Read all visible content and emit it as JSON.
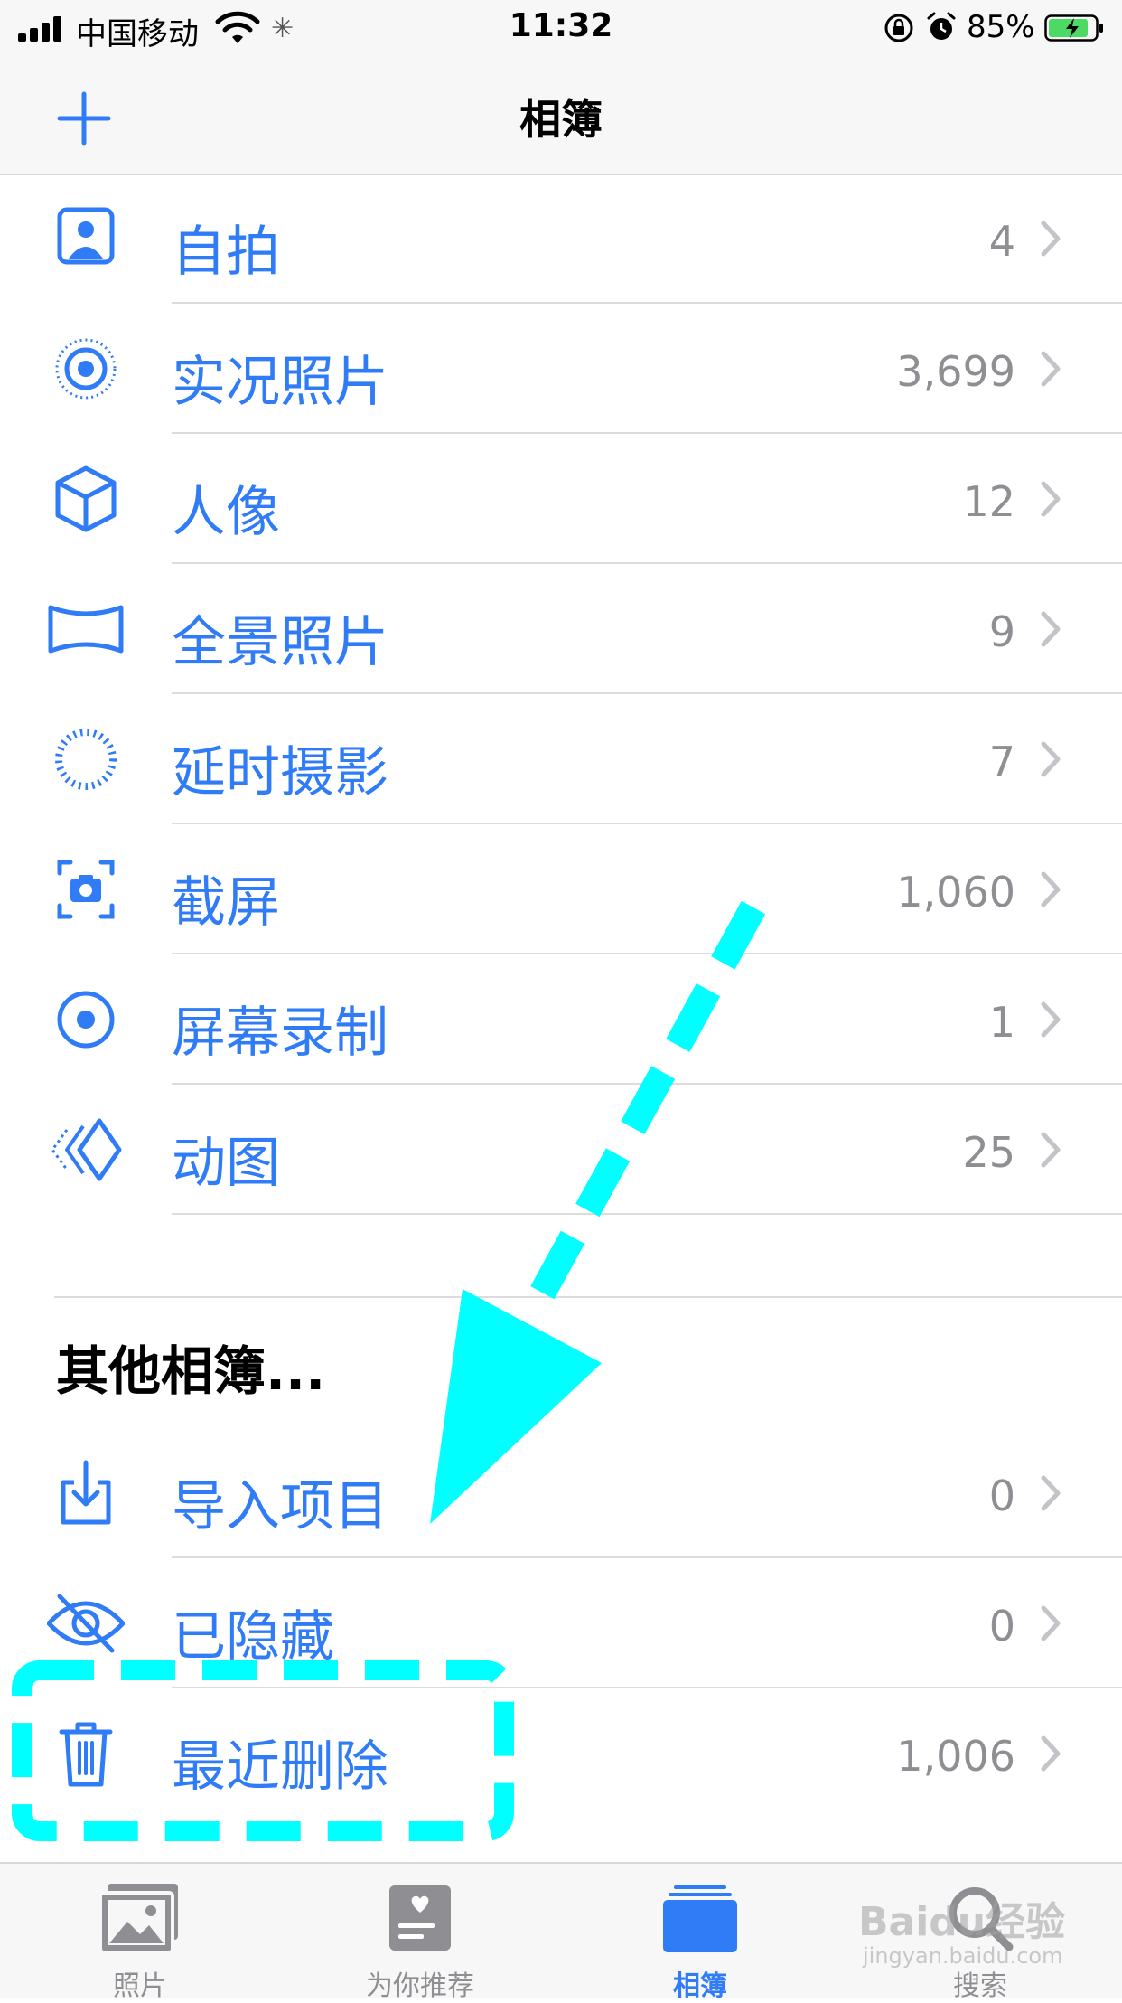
{
  "status": {
    "carrier": "中国移动",
    "time": "11:32",
    "battery_percent": "85%",
    "battery_level": 0.85
  },
  "nav": {
    "title": "相簿",
    "add_icon": "plus-icon"
  },
  "media_types": [
    {
      "label": "自拍",
      "count": "4",
      "icon": "selfie-icon"
    },
    {
      "label": "实况照片",
      "count": "3,699",
      "icon": "live-photo-icon"
    },
    {
      "label": "人像",
      "count": "12",
      "icon": "portrait-cube-icon"
    },
    {
      "label": "全景照片",
      "count": "9",
      "icon": "panorama-icon"
    },
    {
      "label": "延时摄影",
      "count": "7",
      "icon": "timelapse-icon"
    },
    {
      "label": "截屏",
      "count": "1,060",
      "icon": "screenshot-icon"
    },
    {
      "label": "屏幕录制",
      "count": "1",
      "icon": "screen-recording-icon"
    },
    {
      "label": "动图",
      "count": "25",
      "icon": "animated-icon"
    }
  ],
  "other_albums": {
    "title": "其他相簿...",
    "items": [
      {
        "label": "导入项目",
        "count": "0",
        "icon": "import-icon"
      },
      {
        "label": "已隐藏",
        "count": "0",
        "icon": "hidden-eye-icon"
      },
      {
        "label": "最近删除",
        "count": "1,006",
        "icon": "trash-icon"
      }
    ]
  },
  "tabs": [
    {
      "label": "照片",
      "icon": "photos-tab-icon",
      "active": false
    },
    {
      "label": "为你推荐",
      "icon": "for-you-tab-icon",
      "active": false
    },
    {
      "label": "相簿",
      "icon": "albums-tab-icon",
      "active": true
    },
    {
      "label": "搜索",
      "icon": "search-tab-icon",
      "active": false
    }
  ],
  "colors": {
    "accent": "#2f7cf6",
    "annotation": "#00ffff",
    "count_gray": "#8e8e93"
  },
  "watermark": {
    "text": "Baidu经验",
    "sub": "jingyan.baidu.com"
  }
}
